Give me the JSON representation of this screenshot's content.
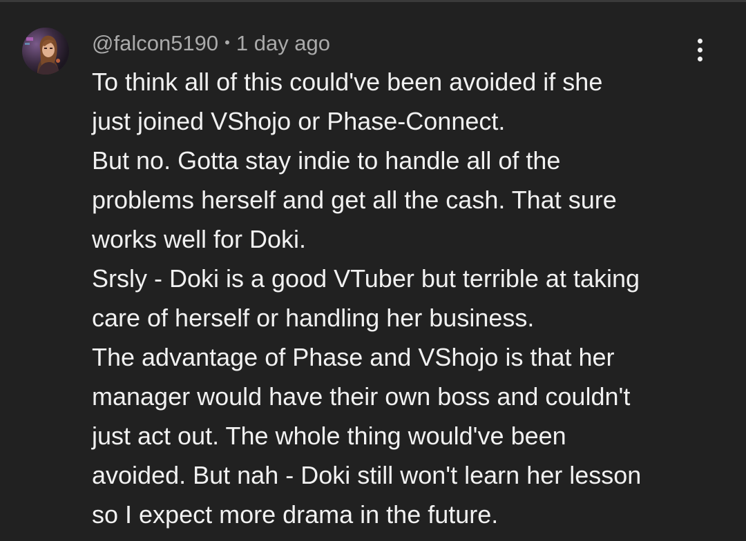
{
  "comment": {
    "author": "@falcon5190",
    "separator": "•",
    "timestamp": "1 day ago",
    "lines": [
      "To think all of this could've been avoided if she",
      "just joined VShojo or Phase-Connect.",
      "But no. Gotta stay indie to handle all of the",
      "problems herself and get all the cash. That sure",
      "works well for Doki.",
      "Srsly - Doki is a good VTuber but terrible at taking",
      "care of herself or handling her business.",
      "The advantage of Phase and VShojo is that her",
      "manager would have their own boss and couldn't",
      "just act out. The whole thing would've been",
      "avoided. But nah - Doki still won't learn her lesson",
      "so I expect more drama in the future."
    ],
    "avatar_icon": "user-avatar",
    "menu_icon": "more-vertical-icon"
  },
  "colors": {
    "background": "#212121",
    "text_primary": "#f1f1f1",
    "text_secondary": "#aaaaaa"
  }
}
